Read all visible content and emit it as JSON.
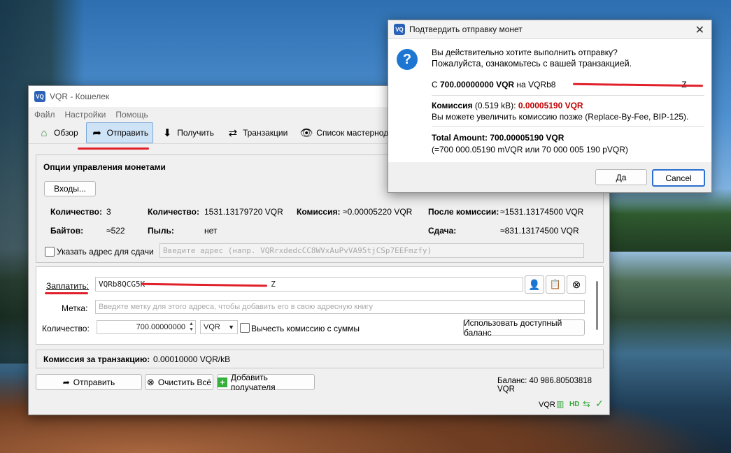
{
  "main_window": {
    "title": "VQR - Кошелек",
    "menu": [
      "Файл",
      "Настройки",
      "Помощь"
    ],
    "toolbar": [
      {
        "label": "Обзор",
        "icon": "home-icon"
      },
      {
        "label": "Отправить",
        "icon": "send-icon",
        "active": true
      },
      {
        "label": "Получить",
        "icon": "receive-icon"
      },
      {
        "label": "Транзакции",
        "icon": "transactions-icon"
      },
      {
        "label": "Список мастернод",
        "icon": "eye-icon"
      }
    ],
    "coin_control": {
      "title": "Опции управления монетами",
      "inputs_button": "Входы...",
      "quantity_label": "Количество:",
      "quantity_value": "3",
      "amount_label": "Количество:",
      "amount_value": "1531.13179720 VQR",
      "fee_label": "Комиссия:",
      "fee_value": "≈0.00005220 VQR",
      "after_fee_label": "После комиссии:",
      "after_fee_value": "≈1531.13174500 VQR",
      "bytes_label": "Байтов:",
      "bytes_value": "≈522",
      "dust_label": "Пыль:",
      "dust_value": "нет",
      "change_label": "Сдача:",
      "change_value": "≈831.13174500 VQR",
      "custom_change_label": "Указать адрес для сдачи",
      "custom_change_placeholder": "Введите адрес (напр. VQRrxdedcCC8WVxAuPvVA95tjCSp7EEFmzfy)"
    },
    "recipient": {
      "pay_to_label": "Заплатить:",
      "pay_to_value": "VQRb8QCG5K",
      "pay_to_value_tail": "Z",
      "label_label": "Метка:",
      "label_placeholder": "Введите метку для этого адреса, чтобы добавить его в свою адресную книгу",
      "amount_label": "Количество:",
      "amount_value": "700.00000000",
      "unit": "VQR",
      "subtract_fee_label": "Вычесть комиссию с суммы",
      "use_balance_button": "Использовать доступный баланс"
    },
    "fee": {
      "label": "Комиссия за транзакцию:",
      "value": "0.00010000 VQR/kB"
    },
    "actions": {
      "send": "Отправить",
      "clear": "Очистить Всё",
      "add_recipient": "Добавить получателя"
    },
    "balance": "Баланс: 40 986.80503818 VQR",
    "status": {
      "unit": "VQR",
      "hd": "HD"
    }
  },
  "dialog": {
    "title": "Подтвердить отправку монет",
    "question_line1": "Вы действительно хотите выполнить отправку?",
    "question_line2": "Пожалуйста, ознакомьтесь с вашей транзакцией.",
    "send_prefix": "С ",
    "send_amount": "700.00000000 VQR",
    "send_to": " на VQRb8",
    "send_tail": "Z",
    "fee_label": "Комиссия",
    "fee_size": " (0.519 kB): ",
    "fee_value": "0.00005190 VQR",
    "fee_note": "Вы можете увеличить комиссию позже (Replace-By-Fee, BIP-125).",
    "total_label": "Total Amount: 700.00005190 VQR",
    "total_detail": "(=700 000.05190 mVQR или 70 000 005 190 pVQR)",
    "yes_button": "Да",
    "cancel_button": "Cancel"
  }
}
